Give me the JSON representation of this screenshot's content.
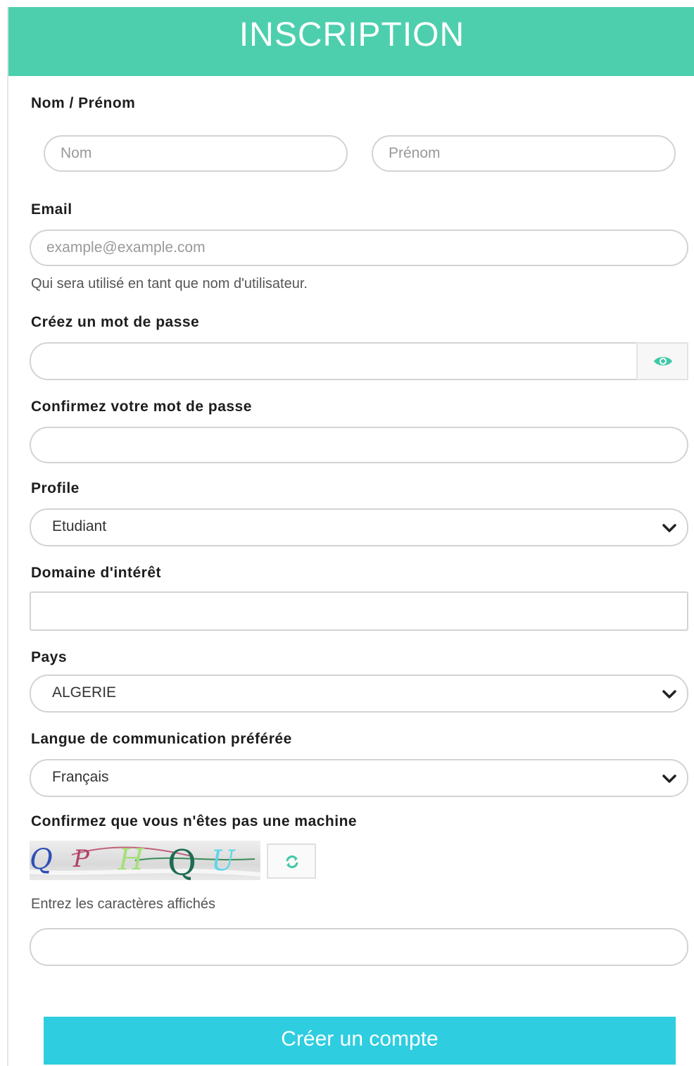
{
  "header": {
    "title": "INSCRIPTION"
  },
  "name_section": {
    "label": "Nom / Prénom",
    "nom_placeholder": "Nom",
    "prenom_placeholder": "Prénom"
  },
  "email": {
    "label": "Email",
    "placeholder": "example@example.com",
    "hint": "Qui sera utilisé en tant que nom d'utilisateur."
  },
  "password": {
    "label": "Créez un mot de passe",
    "toggle_icon": "eye-icon"
  },
  "confirm_password": {
    "label": "Confirmez votre mot de passe"
  },
  "profile": {
    "label": "Profile",
    "selected": "Etudiant"
  },
  "domain": {
    "label": "Domaine d'intérêt",
    "value": ""
  },
  "country": {
    "label": "Pays",
    "selected": "ALGERIE"
  },
  "language": {
    "label": "Langue de communication préférée",
    "selected": "Français"
  },
  "captcha": {
    "label": "Confirmez que vous n'êtes pas une machine",
    "characters": [
      "Q",
      "P",
      "H",
      "Q",
      "U"
    ],
    "hint": "Entrez les caractères affichés",
    "refresh_icon": "refresh-icon"
  },
  "submit": {
    "label": "Créer un compte"
  },
  "colors": {
    "header": "#4dcfae",
    "button": "#2ecde0",
    "accent": "#3ec9a7"
  }
}
